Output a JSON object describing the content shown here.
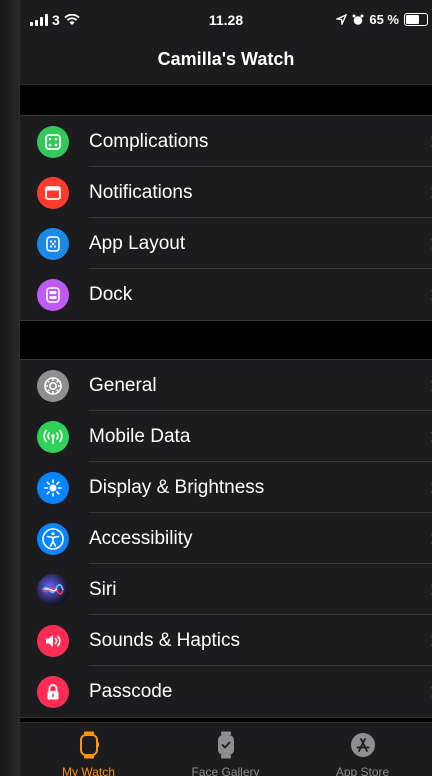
{
  "status_bar": {
    "carrier": "3",
    "time": "11.28",
    "battery": "65 %"
  },
  "nav": {
    "title": "Camilla's Watch"
  },
  "groups": [
    {
      "items": [
        {
          "label": "Complications",
          "icon": "complications-icon",
          "color": "#34c759"
        },
        {
          "label": "Notifications",
          "icon": "notifications-icon",
          "color": "#ff3b30"
        },
        {
          "label": "App Layout",
          "icon": "app-layout-icon",
          "color": "#1e88e5"
        },
        {
          "label": "Dock",
          "icon": "dock-icon",
          "color": "#bf5af2"
        }
      ]
    },
    {
      "items": [
        {
          "label": "General",
          "icon": "gear-icon",
          "color": "#8e8e93"
        },
        {
          "label": "Mobile Data",
          "icon": "antenna-icon",
          "color": "#30d158"
        },
        {
          "label": "Display & Brightness",
          "icon": "sun-icon",
          "color": "#0a84ff"
        },
        {
          "label": "Accessibility",
          "icon": "accessibility-icon",
          "color": "#0a84ff"
        },
        {
          "label": "Siri",
          "icon": "siri-icon",
          "color": "#1c1c1e"
        },
        {
          "label": "Sounds & Haptics",
          "icon": "speaker-icon",
          "color": "#ff2d55"
        },
        {
          "label": "Passcode",
          "icon": "lock-icon",
          "color": "#ff2d55"
        }
      ]
    }
  ],
  "tabs": [
    {
      "label": "My Watch",
      "icon": "watch-icon",
      "active": true
    },
    {
      "label": "Face Gallery",
      "icon": "face-gallery-icon",
      "active": false
    },
    {
      "label": "App Store",
      "icon": "app-store-icon",
      "active": false
    }
  ],
  "colors": {
    "accent": "#ff9500",
    "background": "#000000",
    "cell": "#1c1c1e"
  }
}
